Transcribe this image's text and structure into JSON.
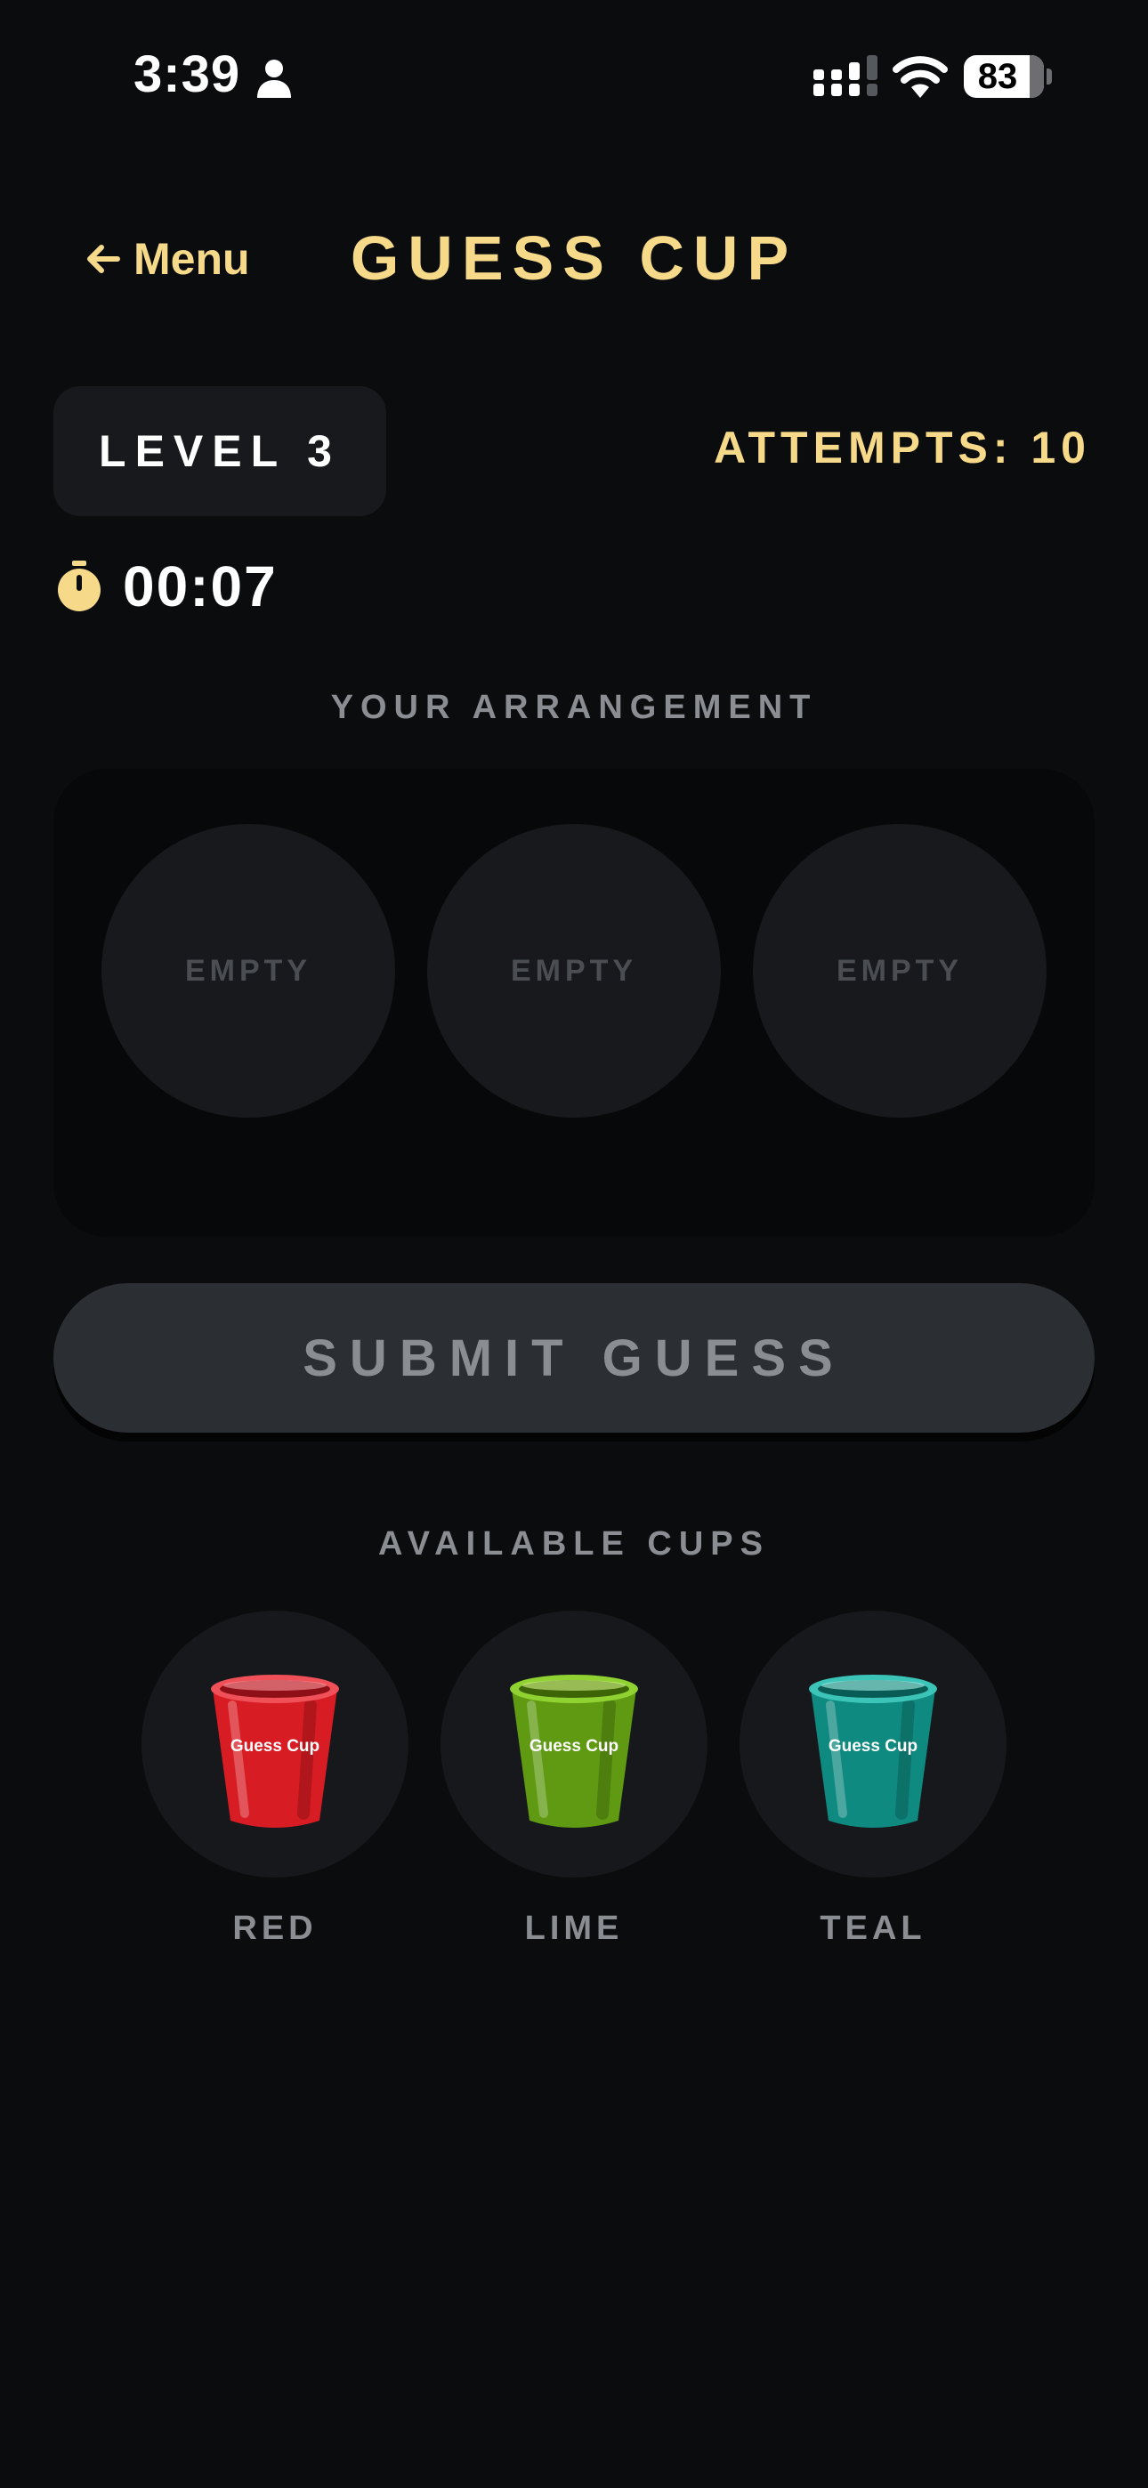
{
  "status_bar": {
    "time": "3:39",
    "battery": "83"
  },
  "header": {
    "back_label": "Menu",
    "title": "GUESS CUP"
  },
  "game": {
    "level_label": "LEVEL 3",
    "attempts_label": "ATTEMPTS: 10",
    "timer": "00:07"
  },
  "arrangement": {
    "heading": "YOUR ARRANGEMENT",
    "slots": [
      "EMPTY",
      "EMPTY",
      "EMPTY"
    ]
  },
  "submit_label": "SUBMIT GUESS",
  "available": {
    "heading": "AVAILABLE CUPS",
    "cups": [
      {
        "name": "RED",
        "cup_text": "Guess Cup",
        "color": "#d81c24"
      },
      {
        "name": "LIME",
        "cup_text": "Guess Cup",
        "color": "#5f9a12"
      },
      {
        "name": "TEAL",
        "cup_text": "Guess Cup",
        "color": "#0f8a80"
      }
    ]
  },
  "colors": {
    "accent": "#f7d98a",
    "background": "#0b0c0e",
    "muted_text": "#8a8d92"
  }
}
